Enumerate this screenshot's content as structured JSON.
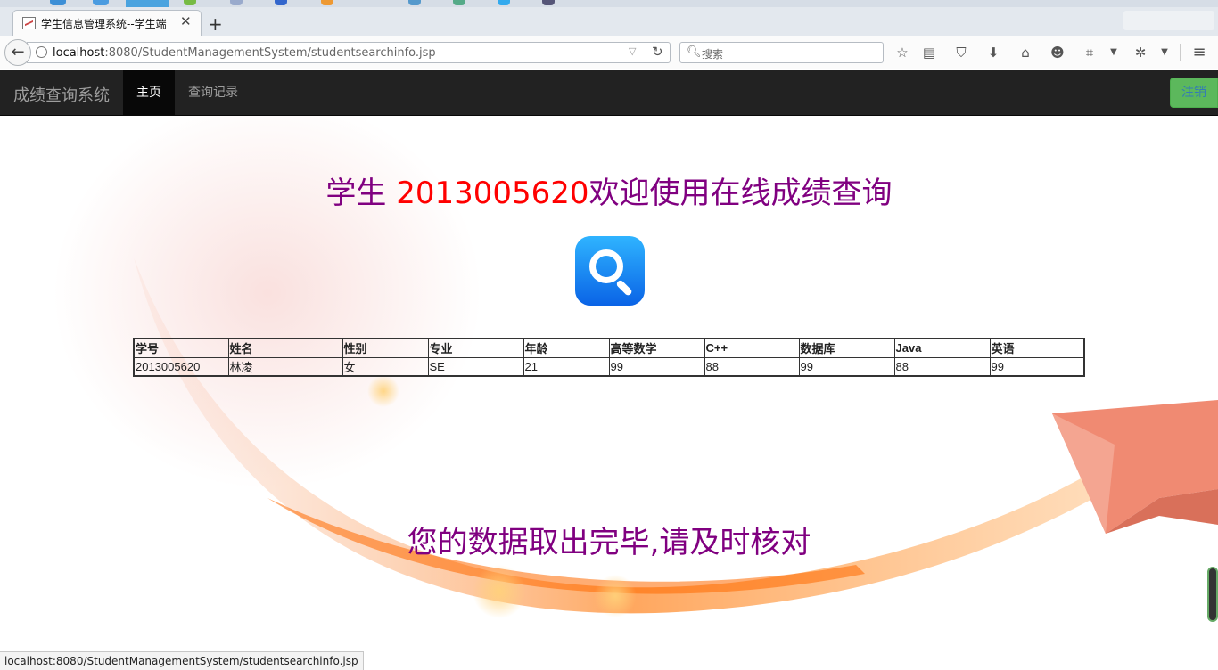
{
  "browser": {
    "tab_title": "学生信息管理系统--学生端",
    "tab_close": "✕",
    "new_tab": "+",
    "url_host": "localhost",
    "url_rest": ":8080/StudentManagementSystem/studentsearchinfo.jsp",
    "search_placeholder": "搜索",
    "status_url": "localhost:8080/StudentManagementSystem/studentsearchinfo.jsp"
  },
  "app": {
    "brand": "成绩查询系统",
    "nav_home": "主页",
    "nav_records": "查询记录",
    "logout": "注销"
  },
  "welcome": {
    "prefix": "学生 ",
    "student_id": "2013005620",
    "suffix": "欢迎使用在线成绩查询"
  },
  "scores_table": {
    "headers": [
      "学号",
      "姓名",
      "性别",
      "专业",
      "年龄",
      "高等数学",
      "C++",
      "数据库",
      "Java",
      "英语"
    ],
    "rows": [
      [
        "2013005620",
        "林凌",
        "女",
        "SE",
        "21",
        "99",
        "88",
        "99",
        "88",
        "99"
      ]
    ]
  },
  "footer_message": "您的数据取出完毕,请及时核对",
  "colors": {
    "heading": "#800080",
    "student_id": "#ff0000",
    "navbar": "#222222",
    "logout_button": "#5cb85c"
  }
}
